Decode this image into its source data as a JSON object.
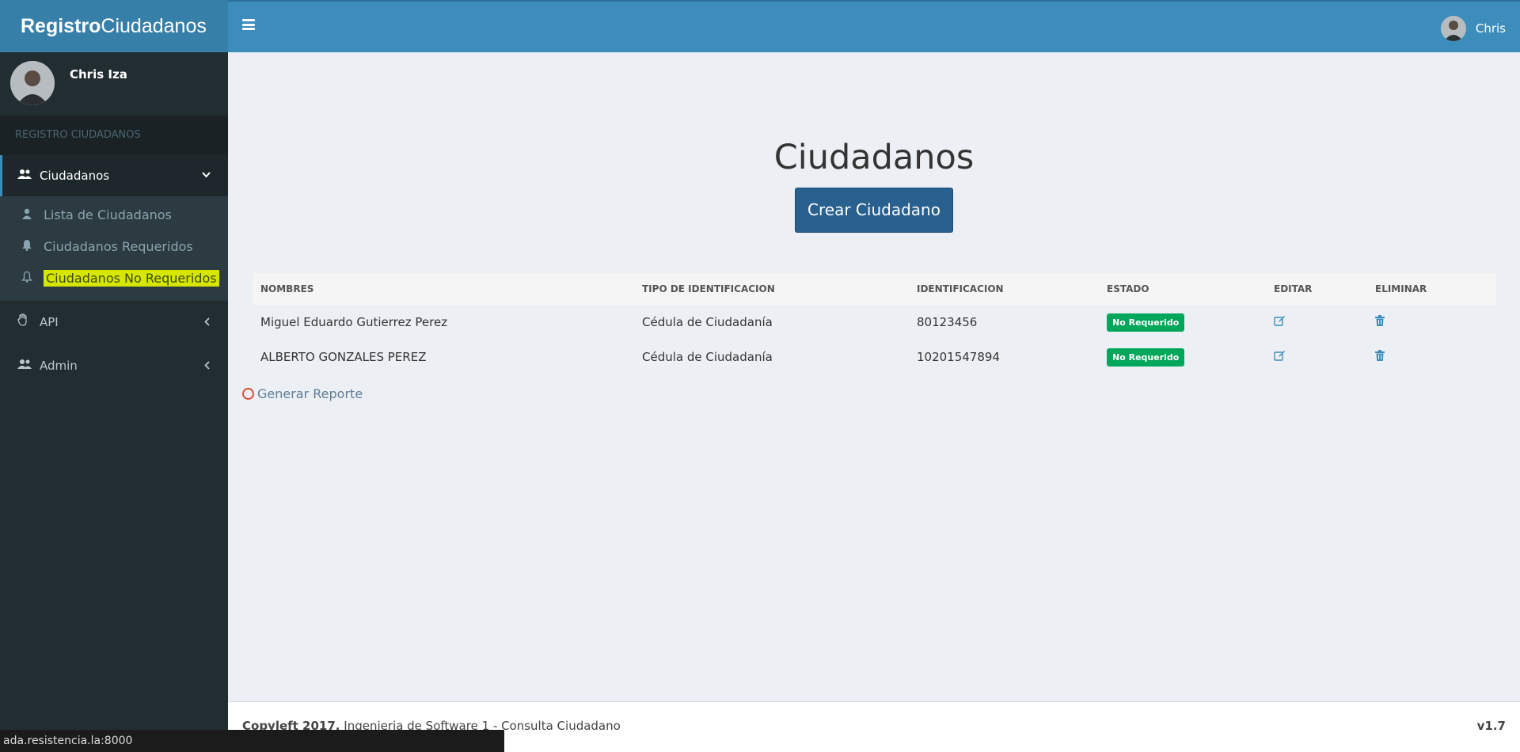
{
  "header": {
    "logo_bold": "Registro",
    "logo_rest": "Ciudadanos",
    "user_name": "Chris"
  },
  "sidebar": {
    "user_full_name": "Chris Iza",
    "section_label": "REGISTRO CIUDADANOS",
    "ciudadanos_label": "Ciudadanos",
    "submenu": [
      {
        "label": "Lista de Ciudadanos",
        "icon": "user-icon"
      },
      {
        "label": "Ciudadanos Requeridos",
        "icon": "bell-icon"
      },
      {
        "label": "Ciudadanos No Requeridos",
        "icon": "bell-outline-icon"
      }
    ],
    "api_label": "API",
    "admin_label": "Admin"
  },
  "main": {
    "title": "Ciudadanos",
    "create_button": "Crear Ciudadano",
    "columns": [
      "NOMBRES",
      "TIPO DE IDENTIFICACION",
      "IDENTIFICACION",
      "ESTADO",
      "EDITAR",
      "ELIMINAR"
    ],
    "rows": [
      {
        "nombres": "Miguel Eduardo Gutierrez Perez",
        "tipo": "Cédula de Ciudadanía",
        "identificacion": "80123456",
        "estado": "No Requerido"
      },
      {
        "nombres": "ALBERTO GONZALES PEREZ",
        "tipo": "Cédula de Ciudadanía",
        "identificacion": "10201547894",
        "estado": "No Requerido"
      }
    ],
    "report_link": "Generar Reporte"
  },
  "footer": {
    "copyleft": "Copyleft 2017.",
    "text": " Ingenieria de Software 1 - Consulta Ciudadano",
    "version": "v1.7"
  },
  "status_bar": {
    "url": "ada.resistencia.la:8000"
  },
  "colors": {
    "header": "#3c8dbc",
    "logo_bg": "#367fa9",
    "sidebar": "#222d32",
    "primary_button": "#286090",
    "badge_green": "#00a65a",
    "highlight": "#d6e600"
  }
}
